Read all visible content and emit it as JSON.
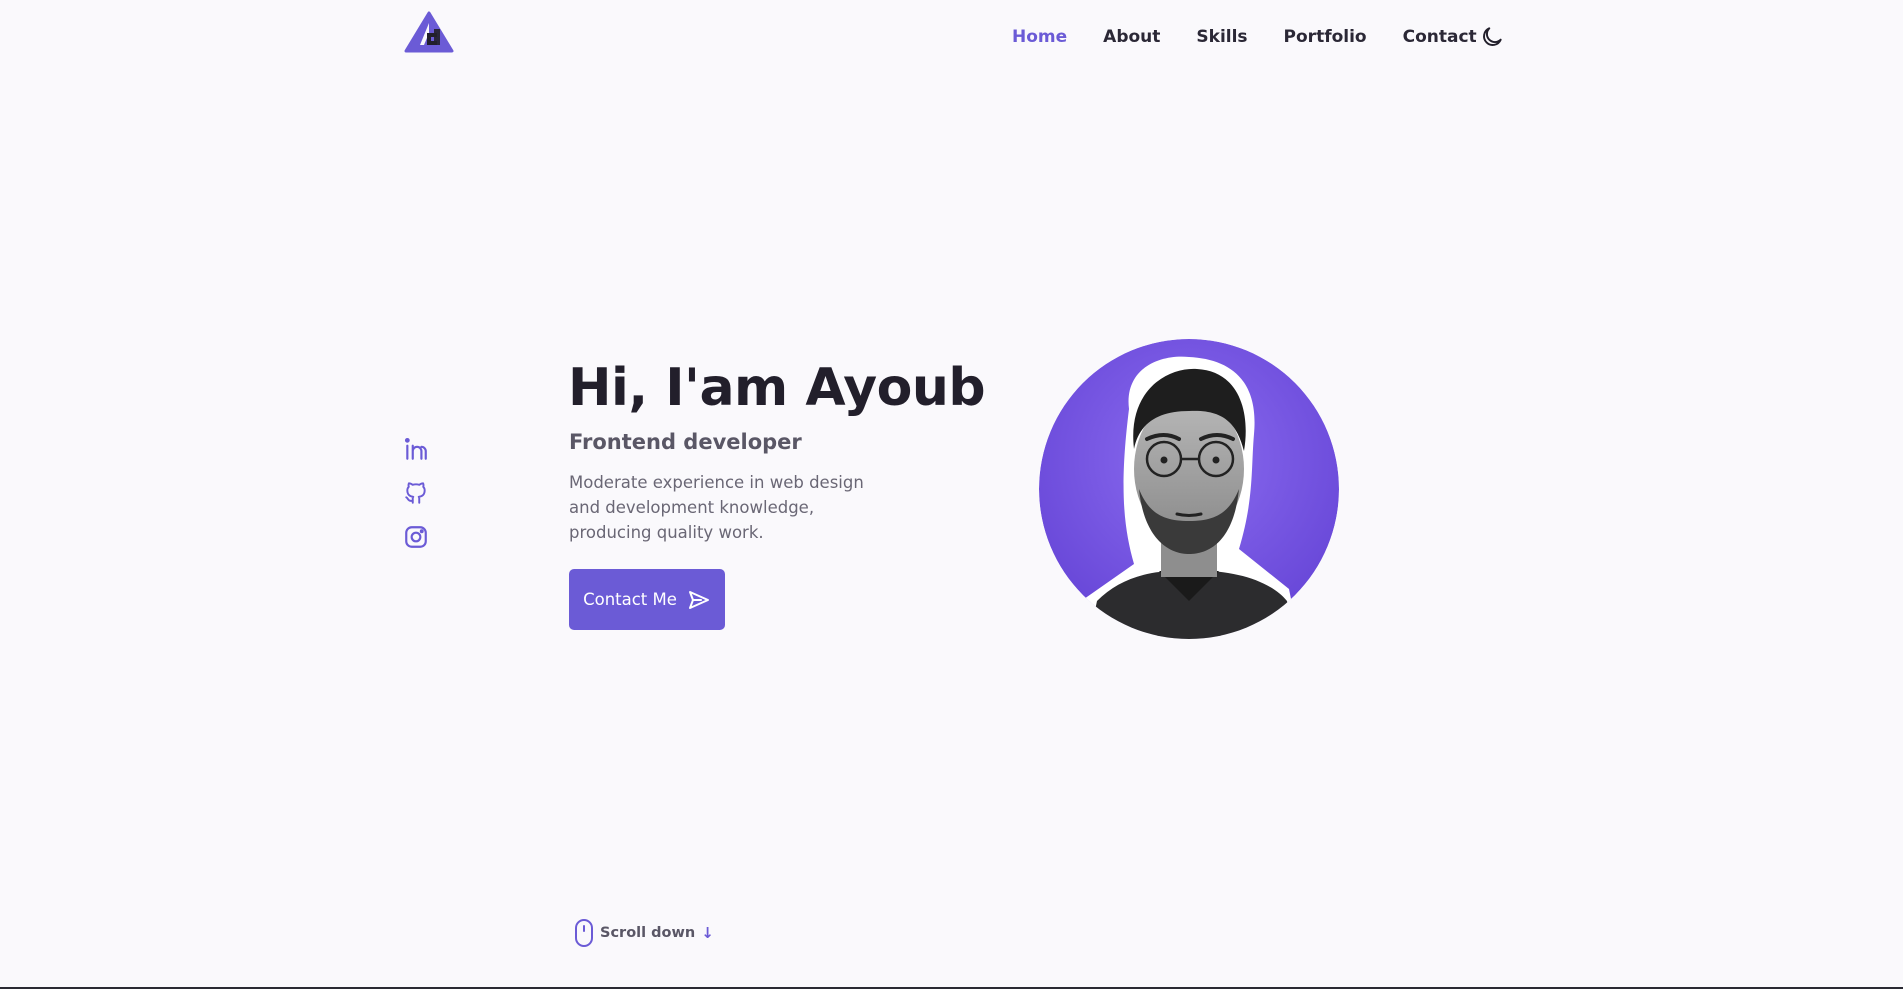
{
  "nav": {
    "items": [
      {
        "label": "Home",
        "active": true
      },
      {
        "label": "About",
        "active": false
      },
      {
        "label": "Skills",
        "active": false
      },
      {
        "label": "Portfolio",
        "active": false
      },
      {
        "label": "Contact",
        "active": false
      }
    ],
    "theme_toggle_icon": "moon-icon"
  },
  "social": {
    "icons": [
      "linkedin-icon",
      "github-icon",
      "instagram-icon"
    ]
  },
  "hero": {
    "title": "Hi, I'am Ayoub",
    "subtitle": "Frontend developer",
    "description": "Moderate experience in web design and development knowledge, producing quality work.",
    "button_label": "Contact Me",
    "button_icon": "send-icon"
  },
  "scroll": {
    "label": "Scroll down",
    "arrow": "↓"
  },
  "colors": {
    "accent": "#6b5bd6",
    "background": "#faf9fc",
    "title": "#221f2b",
    "text": "#6a6775"
  }
}
